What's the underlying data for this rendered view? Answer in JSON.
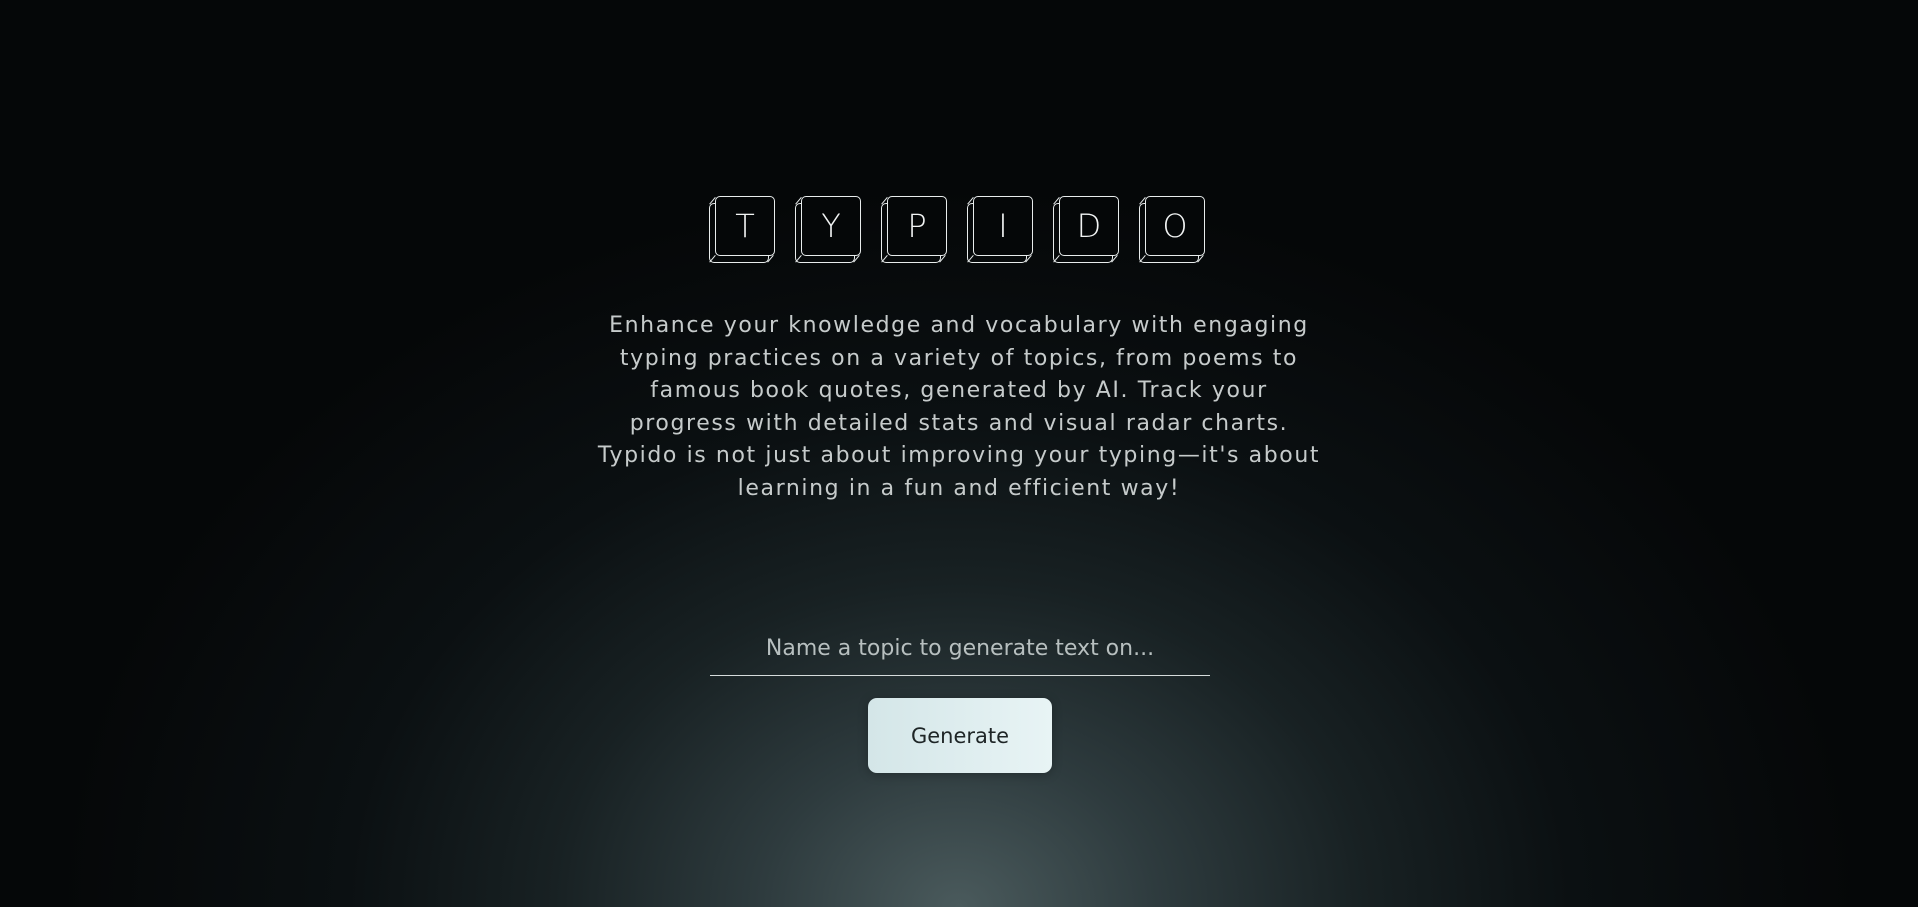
{
  "logo": {
    "letters": [
      "T",
      "Y",
      "P",
      "I",
      "D",
      "O"
    ]
  },
  "hero": {
    "description": "Enhance your knowledge and vocabulary with engaging typing practices on a variety of topics, from poems to famous book quotes, generated by AI. Track your progress with detailed stats and visual radar charts. Typido is not just about improving your typing—it's about learning in a fun and efficient way!"
  },
  "form": {
    "topic_placeholder": "Name a topic to generate text on...",
    "topic_value": "",
    "generate_label": "Generate"
  },
  "colors": {
    "background": "#050708",
    "glow": "#4a5a5c",
    "text_muted": "#c6cbcb",
    "button_bg": "#e2f0f1",
    "button_text": "#1e2526"
  }
}
